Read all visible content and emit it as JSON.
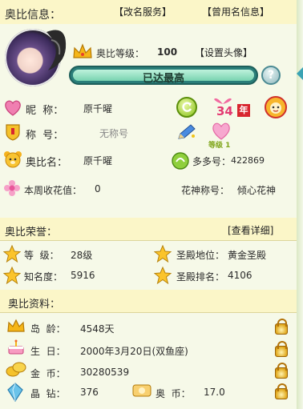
{
  "header": {
    "title": "奥比信息：",
    "rename_service": "【改名服务】",
    "used_names": "【曾用名信息】"
  },
  "profile": {
    "level_label": "奥比等级：",
    "level_value": "100",
    "set_avatar": "【设置头像】",
    "progress_text": "已达最高",
    "progress_fraction": 1.0,
    "help_glyph": "?"
  },
  "info": {
    "nickname_label": "昵  称：",
    "nickname_value": "原千曜",
    "title_label": "称  号：",
    "title_value": "无称号",
    "obi_name_label": "奥比名：",
    "obi_name_value": "原千曜",
    "duoduo_label": "多多号：",
    "duoduo_value": "422869",
    "flower_label": "本周收花值：",
    "flower_value": "0",
    "flower_title_label": "花神称号：",
    "flower_title_value": "倾心花神",
    "year_badge_number": "34",
    "year_badge_text": "年",
    "heart_badge_text": "等级 1"
  },
  "honor": {
    "title": "奥比荣誉：",
    "view_detail": "[查看详细]",
    "grade_label": "等  级：",
    "grade_value": "28级",
    "palace_label": "圣殿地位：",
    "palace_value": "黄金圣殿",
    "fame_label": "知名度：",
    "fame_value": "5916",
    "rank_label": "圣殿排名：",
    "rank_value": "4106"
  },
  "data": {
    "title": "奥比资料：",
    "age_label": "岛  龄：",
    "age_value": "4548天",
    "birthday_label": "生  日：",
    "birthday_value": "2000年3月20日(双鱼座)",
    "coin_label": "金  币：",
    "coin_value": "30280539",
    "crystal_label": "晶  钻：",
    "crystal_value": "376",
    "obi_coin_label": "奥  币：",
    "obi_coin_value": "17.0"
  },
  "colors": {
    "accent": "#2d9d8f",
    "header_bg": "#fbf6c8",
    "page_bg": "#f6f9e8"
  }
}
